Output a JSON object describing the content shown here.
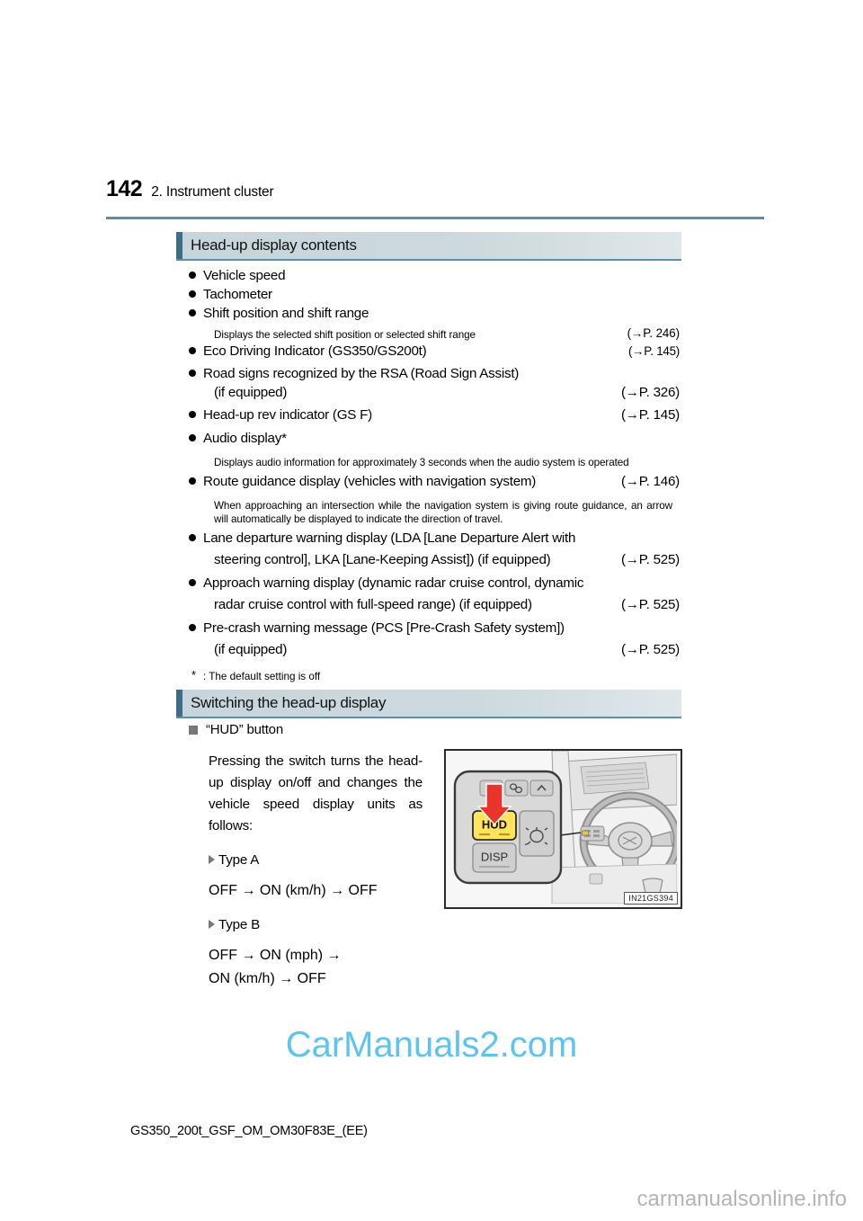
{
  "page": {
    "number": "142",
    "chapter": "2. Instrument cluster",
    "footer_code": "GS350_200t_GSF_OM_OM30F83E_(EE)"
  },
  "watermarks": {
    "center": "CarManuals2.com",
    "corner": "carmanualsonline.info"
  },
  "sections": [
    {
      "id": "contents",
      "title": "Head-up display contents"
    },
    {
      "id": "switching",
      "title": "Switching the head-up display"
    }
  ],
  "contents_list": [
    {
      "text": "Vehicle speed",
      "ref": ""
    },
    {
      "text": "Tachometer",
      "ref": ""
    },
    {
      "text": "Shift position and shift range",
      "ref": ""
    },
    {
      "sub": "Displays the selected shift position or selected shift range",
      "ref": "(→P. 246)"
    },
    {
      "text": "Eco Driving Indicator (GS350/GS200t)",
      "ref": "(→P. 145)"
    },
    {
      "text": "Road signs recognized by the RSA (Road Sign Assist)",
      "ref": ""
    },
    {
      "cont": "(if equipped)",
      "ref": "(→P. 326)"
    },
    {
      "text": "Head-up rev indicator (GS F)",
      "ref": "(→P. 145)"
    },
    {
      "text": "Audio display*",
      "ref": ""
    },
    {
      "sub": "Displays audio information for approximately 3 seconds when the audio system is operated",
      "ref": ""
    },
    {
      "text": "Route guidance display (vehicles with navigation system)",
      "ref": "(→P. 146)"
    },
    {
      "sub": "When approaching an intersection while the navigation system is giving route guidance, an arrow will automatically be displayed to indicate the direction of travel.",
      "ref": ""
    },
    {
      "text": "Lane departure warning display (LDA [Lane Departure Alert with",
      "ref": ""
    },
    {
      "cont": "steering control], LKA [Lane-Keeping Assist]) (if equipped)",
      "ref": "(→P. 525)"
    },
    {
      "text": "Approach warning display (dynamic radar cruise control, dynamic",
      "ref": ""
    },
    {
      "cont": "radar cruise control with full-speed range) (if equipped)",
      "ref": "(→P. 525)"
    },
    {
      "text": "Pre-crash warning message (PCS [Pre-Crash Safety system])",
      "ref": ""
    },
    {
      "cont": "(if equipped)",
      "ref": "(→P. 525)"
    }
  ],
  "footnote": {
    "marker": "*",
    "text": ": The default setting is off"
  },
  "switching": {
    "subsection_title": "“HUD” button",
    "paragraph": "Pressing the switch turns the head-up display on/off and changes the vehicle speed display units as follows:",
    "types": [
      {
        "label": "Type A",
        "flow": "OFF → ON (km/h) → OFF"
      },
      {
        "label": "Type B",
        "flow_line1": "OFF → ON (mph) →",
        "flow_line2": "ON (km/h) → OFF"
      }
    ]
  },
  "illustration": {
    "id_label": "IN21GS394",
    "buttons": {
      "hud": "HUD",
      "disp": "DISP"
    },
    "accent_color": "#ffe45c",
    "arrow_color": "#e8342a"
  },
  "colors": {
    "rule": "#5f8fa8",
    "section_bar_accent": "#3c6e87",
    "section_bar_bg": "#cdd9de",
    "watermark_blue": "#5ec4ef",
    "watermark_gray": "#b4b4b4"
  }
}
